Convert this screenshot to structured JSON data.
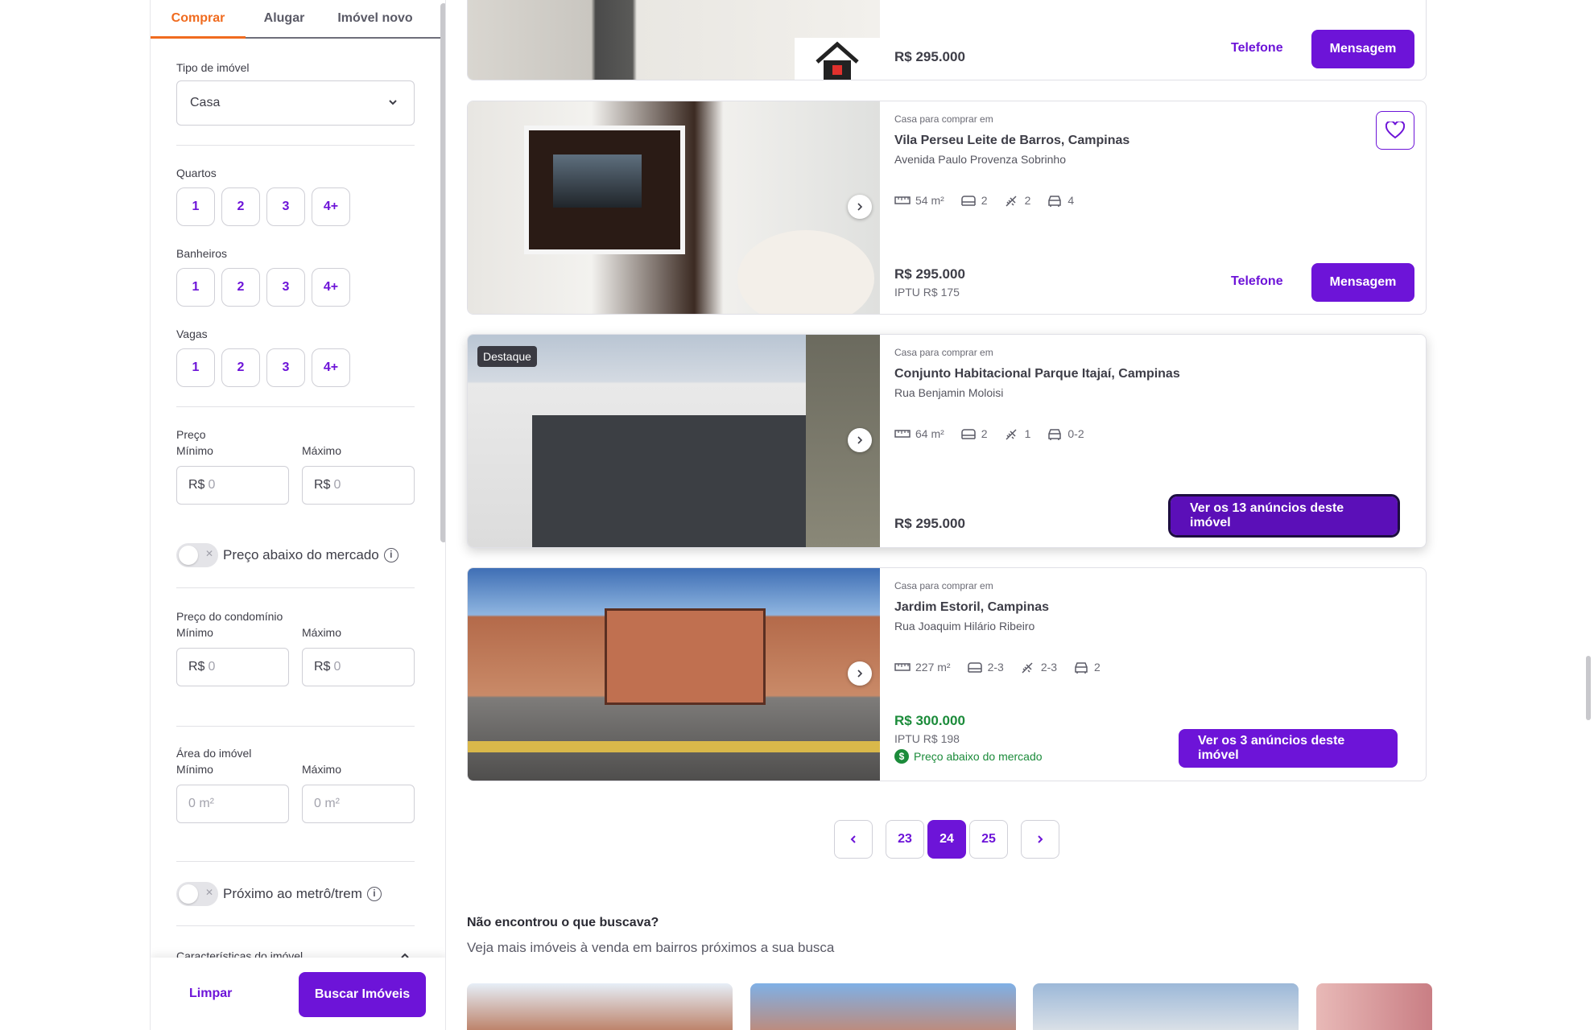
{
  "sidebar": {
    "tabs": [
      "Comprar",
      "Alugar",
      "Imóvel novo"
    ],
    "tipo_label": "Tipo de imóvel",
    "tipo_value": "Casa",
    "quartos_label": "Quartos",
    "banheiros_label": "Banheiros",
    "vagas_label": "Vagas",
    "chips": [
      "1",
      "2",
      "3",
      "4+"
    ],
    "preco_label": "Preço",
    "min_label": "Mínimo",
    "max_label": "Máximo",
    "currency": "R$",
    "zero": "0",
    "area_placeholder": "0 m²",
    "preco_abaixo_label": "Preço abaixo do mercado",
    "condominio_label": "Preço do condomínio",
    "area_label": "Área do imóvel",
    "metro_label": "Próximo ao metrô/trem",
    "caracteristicas_label": "Características do imóvel",
    "limpar": "Limpar",
    "buscar": "Buscar Imóveis"
  },
  "cards": [
    {
      "price": "R$ 295.000",
      "telefone": "Telefone",
      "mensagem": "Mensagem"
    },
    {
      "kicker": "Casa para comprar em",
      "title": "Vila Perseu Leite de Barros, Campinas",
      "address": "Avenida Paulo Provenza Sobrinho",
      "area": "54 m²",
      "quartos": "2",
      "banheiros": "2",
      "vagas": "4",
      "price": "R$ 295.000",
      "iptu": "IPTU R$ 175",
      "telefone": "Telefone",
      "mensagem": "Mensagem"
    },
    {
      "badge": "Destaque",
      "kicker": "Casa para comprar em",
      "title": "Conjunto Habitacional Parque Itajaí, Campinas",
      "address": "Rua Benjamin Moloisi",
      "area": "64 m²",
      "quartos": "2",
      "banheiros": "1",
      "vagas": "0-2",
      "price": "R$ 295.000",
      "cta": "Ver os 13 anúncios deste imóvel"
    },
    {
      "kicker": "Casa para comprar em",
      "title": "Jardim Estoril, Campinas",
      "address": "Rua Joaquim Hilário Ribeiro",
      "area": "227 m²",
      "quartos": "2-3",
      "banheiros": "2-3",
      "vagas": "2",
      "price": "R$ 300.000",
      "iptu": "IPTU R$ 198",
      "below_market": "Preço abaixo do mercado",
      "cta": "Ver os 3 anúncios deste imóvel"
    }
  ],
  "pagination": {
    "pages": [
      "23",
      "24",
      "25"
    ],
    "current": "24"
  },
  "not_found": {
    "title": "Não encontrou o que buscava?",
    "subtitle": "Veja mais imóveis à venda em bairros próximos a sua busca"
  },
  "colors": {
    "accent": "#6d14d8",
    "tab_active": "#f06b1f",
    "green": "#1b8b3a"
  }
}
